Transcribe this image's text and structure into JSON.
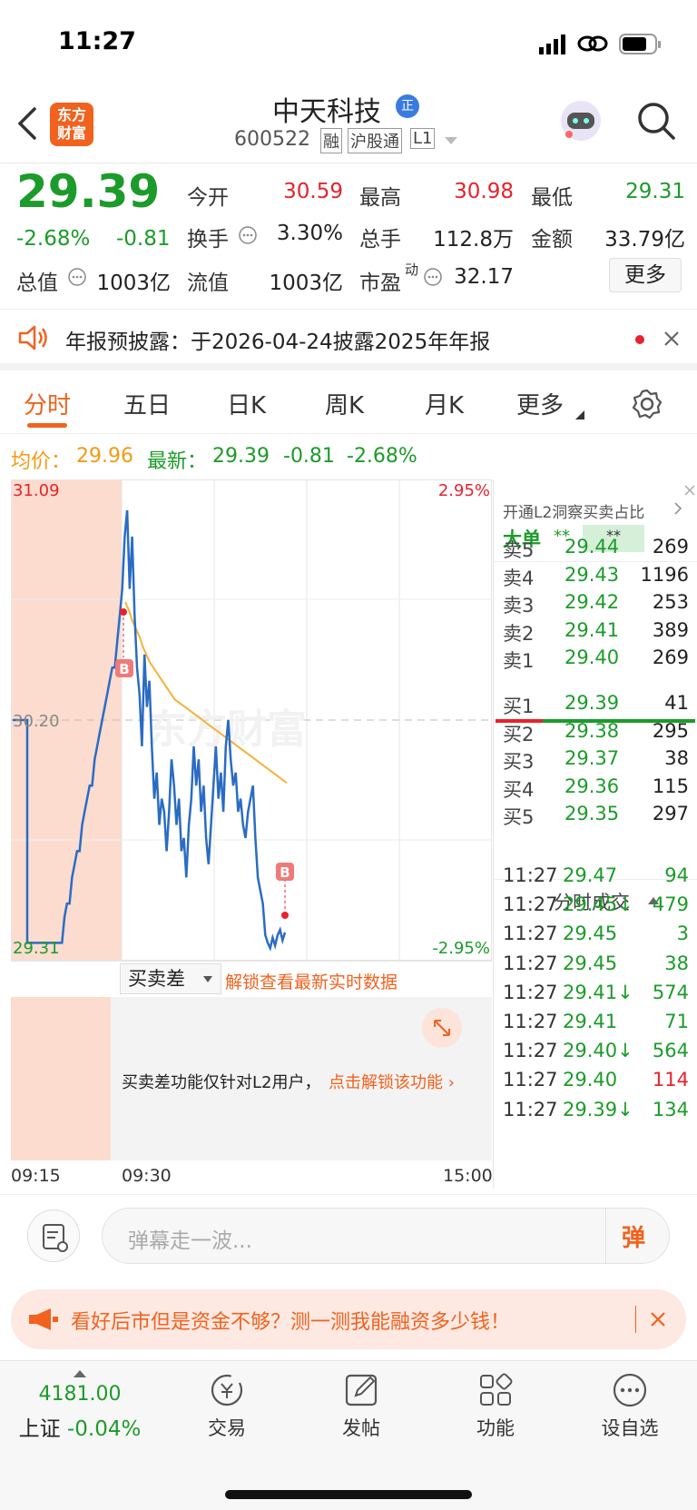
{
  "status_bar": {
    "time": "11:27"
  },
  "header": {
    "stock_name": "中天科技",
    "badge": "正",
    "code": "600522",
    "tag_margin": "融",
    "tag_connect": "沪股通",
    "tag_level": "L1",
    "logo_text_line1": "东方",
    "logo_text_line2": "财富"
  },
  "quote": {
    "price": "29.39",
    "change_pct": "-2.68%",
    "change": "-0.81",
    "open_label": "今开",
    "open": "30.59",
    "high_label": "最高",
    "high": "30.98",
    "low_label": "最低",
    "low": "29.31",
    "turnover_label": "换手",
    "turnover": "3.30%",
    "volume_label": "总手",
    "volume": "112.8万",
    "amount_label": "金额",
    "amount": "33.79亿",
    "total_cap_label": "总值",
    "total_cap": "1003亿",
    "float_cap_label": "流值",
    "float_cap": "1003亿",
    "pe_label": "市盈",
    "pe_sup": "动",
    "pe": "32.17",
    "more_button": "更多"
  },
  "notice": {
    "text": "年报预披露：于2026-04-24披露2025年年报"
  },
  "tabs": [
    "分时",
    "五日",
    "日K",
    "周K",
    "月K",
    "更多"
  ],
  "avg_row": {
    "avg_label": "均价：",
    "avg": "29.96",
    "latest_label": "最新：",
    "latest": "29.39",
    "change": "-0.81",
    "change_pct": "-2.68%"
  },
  "chart_data": {
    "type": "line",
    "y_max": "31.09",
    "y_min": "29.31",
    "y_mid": "30.20",
    "pct_max": "2.95%",
    "pct_min": "-2.95%",
    "watermark": "东方财富",
    "ylim": [
      29.31,
      31.09
    ],
    "time_labels": [
      "09:15",
      "09:30",
      "15:00"
    ],
    "series": [
      {
        "values": [
          30.2,
          30.2,
          29.35,
          29.35,
          29.35,
          29.35,
          29.35,
          29.45,
          29.5,
          29.5,
          29.6,
          29.65,
          29.7,
          29.7,
          29.8,
          29.85,
          29.9,
          29.95,
          29.95,
          30.05,
          30.1,
          30.15,
          30.2,
          30.25,
          30.3,
          30.35,
          30.4,
          30.4,
          30.5,
          30.6,
          30.7,
          30.9,
          31.0,
          30.7,
          30.9,
          30.6,
          30.4,
          30.3,
          30.1,
          30.45,
          30.25,
          30.35,
          30.1,
          29.9,
          30.0,
          29.8,
          29.9,
          29.85,
          29.7,
          29.85,
          30.05,
          29.95,
          29.8,
          29.9,
          29.7,
          29.75,
          29.6,
          29.8,
          29.9,
          30.1,
          29.95,
          30.05,
          29.85,
          29.95,
          29.75,
          29.65,
          29.8,
          29.95,
          30.1,
          29.9,
          30.0,
          29.85,
          30.1,
          30.2,
          30.05,
          29.95,
          30.0,
          29.85,
          29.9,
          29.8,
          29.75,
          29.85,
          29.9,
          29.95,
          29.75,
          29.6,
          29.55,
          29.5,
          29.38,
          29.35,
          29.33,
          29.37,
          29.34,
          29.38,
          29.4,
          29.36,
          29.39
        ]
      },
      {
        "values": [
          30.65,
          30.62,
          30.58,
          30.55,
          30.52,
          30.48,
          30.45,
          30.42,
          30.4,
          30.38,
          30.36,
          30.34,
          30.32,
          30.3,
          30.28,
          30.27,
          30.26,
          30.25,
          30.24,
          30.23,
          30.22,
          30.21,
          30.2,
          30.19,
          30.18,
          30.17,
          30.16,
          30.15,
          30.14,
          30.13,
          30.12,
          30.11,
          30.1,
          30.09,
          30.08,
          30.07,
          30.06,
          30.05,
          30.04,
          30.03,
          30.02,
          30.01,
          30.0,
          29.99,
          29.98,
          29.97,
          29.96
        ]
      }
    ],
    "buy_markers": [
      "B",
      "B"
    ]
  },
  "level2": {
    "promo": "开通L2洞察买卖占比",
    "big_order_label": "大单",
    "big_order_v1": "**",
    "big_order_v2": "**"
  },
  "asks": [
    {
      "label": "卖5",
      "price": "29.44",
      "vol": "269"
    },
    {
      "label": "卖4",
      "price": "29.43",
      "vol": "1196"
    },
    {
      "label": "卖3",
      "price": "29.42",
      "vol": "253"
    },
    {
      "label": "卖2",
      "price": "29.41",
      "vol": "389"
    },
    {
      "label": "卖1",
      "price": "29.40",
      "vol": "269"
    }
  ],
  "bids": [
    {
      "label": "买1",
      "price": "29.39",
      "vol": "41"
    },
    {
      "label": "买2",
      "price": "29.38",
      "vol": "295"
    },
    {
      "label": "买3",
      "price": "29.37",
      "vol": "38"
    },
    {
      "label": "买4",
      "price": "29.36",
      "vol": "115"
    },
    {
      "label": "买5",
      "price": "29.35",
      "vol": "297"
    }
  ],
  "ticks_title": "分时成交",
  "ticks": [
    {
      "time": "11:27",
      "price": "29.47",
      "vol": "94",
      "color": "#1c9b2a"
    },
    {
      "time": "11:27",
      "price": "29.45↓",
      "vol": "479",
      "color": "#1c9b2a"
    },
    {
      "time": "11:27",
      "price": "29.45",
      "vol": "3",
      "color": "#1c9b2a"
    },
    {
      "time": "11:27",
      "price": "29.45",
      "vol": "38",
      "color": "#1c9b2a"
    },
    {
      "time": "11:27",
      "price": "29.41↓",
      "vol": "574",
      "color": "#1c9b2a"
    },
    {
      "time": "11:27",
      "price": "29.41",
      "vol": "71",
      "color": "#1c9b2a"
    },
    {
      "time": "11:27",
      "price": "29.40↓",
      "vol": "564",
      "color": "#1c9b2a"
    },
    {
      "time": "11:27",
      "price": "29.40",
      "vol": "114",
      "color": "#e8222b"
    },
    {
      "time": "11:27",
      "price": "29.39↓",
      "vol": "134",
      "color": "#1c9b2a"
    }
  ],
  "diff": {
    "select": "买卖差",
    "unlock_link": "解锁查看最新实时数据",
    "lock_text": "买卖差功能仅针对L2用户，",
    "lock_link": "点击解锁该功能"
  },
  "comment": {
    "placeholder": "弹幕走一波...",
    "button": "弹"
  },
  "promo": {
    "text": "看好后市但是资金不够？测一测我能融资多少钱！"
  },
  "tabbar": {
    "index_value": "4181.00",
    "index_name": "上证",
    "index_change": "-0.04%",
    "trade": "交易",
    "post": "发帖",
    "function": "功能",
    "watchlist": "设自选"
  },
  "colors": {
    "up": "#e8222b",
    "down": "#1c9b2a",
    "accent": "#f0621e",
    "price_line": "#2a6cc4",
    "avg_line": "#f5b234"
  }
}
